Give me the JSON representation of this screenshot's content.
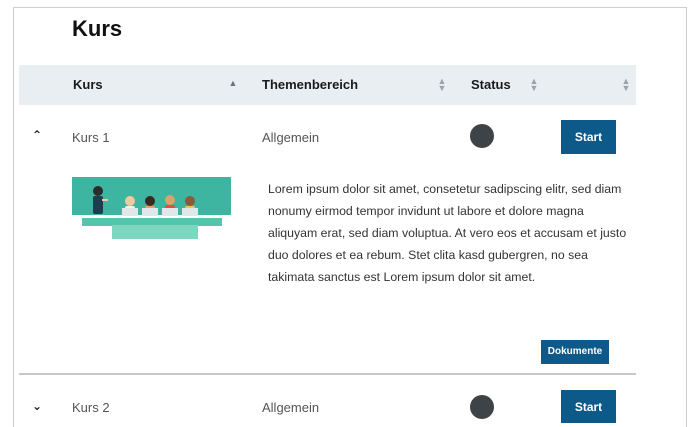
{
  "page": {
    "title": "Kurs"
  },
  "table": {
    "headers": [
      {
        "label": "Kurs",
        "sort": "asc"
      },
      {
        "label": "Themenbereich",
        "sort": "none"
      },
      {
        "label": "Status",
        "sort": "none"
      },
      {
        "label": "",
        "sort": "none"
      }
    ],
    "rows": [
      {
        "expanded": true,
        "name": "Kurs 1",
        "topic": "Allgemein",
        "status_color": "#3e4347",
        "action_label": "Start",
        "description": "Lorem ipsum dolor sit amet, consetetur sadipscing elitr, sed diam nonumy eirmod tempor invidunt ut labore et dolore magna aliquyam erat, sed diam voluptua. At vero eos et accusam et justo duo dolores et ea rebum. Stet clita kasd gubergren, no sea takimata sanctus est Lorem ipsum dolor sit amet.",
        "documents_label": "Dokumente",
        "image": "classroom-illustration"
      },
      {
        "expanded": false,
        "name": "Kurs 2",
        "topic": "Allgemein",
        "status_color": "#3e4347",
        "action_label": "Start"
      }
    ]
  },
  "icons": {
    "expanded": "chevron-up-icon",
    "collapsed": "chevron-down-icon",
    "sort": "sort-arrows-icon"
  },
  "colors": {
    "accent": "#0d5a8a",
    "header_bg": "#e9eef3",
    "illustration": "#3db5a0"
  }
}
